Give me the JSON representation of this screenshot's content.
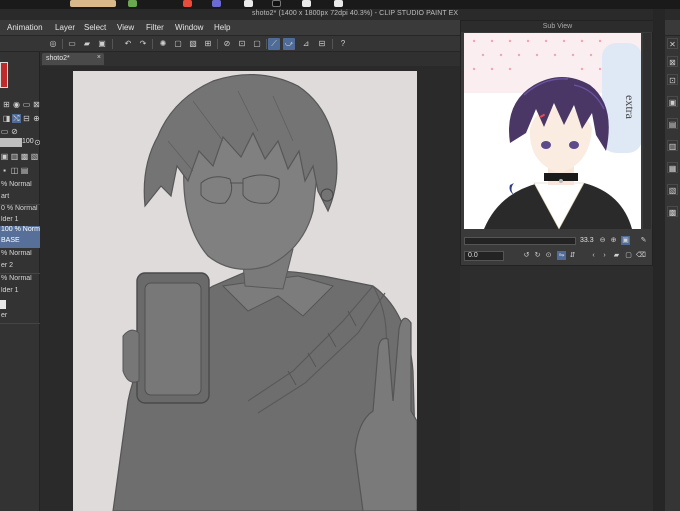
{
  "window": {
    "title": "shoto2* (1400 x 1800px 72dpi 40.3%) - CLIP STUDIO PAINT EX"
  },
  "menu": [
    "Animation",
    "Layer",
    "Select",
    "View",
    "Filter",
    "Window",
    "Help"
  ],
  "document_tab": {
    "label": "shoto2*",
    "close": "×"
  },
  "layer_panel": {
    "opacity_value": "100",
    "layers": [
      {
        "label": "% Normal",
        "selected": false
      },
      {
        "label": "art",
        "selected": false
      },
      {
        "label": "0 % Normal",
        "selected": false
      },
      {
        "label": "lder 1",
        "selected": false
      },
      {
        "label": "100 % Normal",
        "selected": true
      },
      {
        "label": "BASE",
        "selected": true
      },
      {
        "label": "% Normal",
        "selected": false
      },
      {
        "label": "er 2",
        "selected": false
      },
      {
        "label": "% Normal",
        "selected": false
      },
      {
        "label": "lder 1",
        "selected": false
      },
      {
        "label": "er",
        "selected": false
      }
    ]
  },
  "sub_view": {
    "header": "Sub View",
    "zoom": "33.3",
    "rotation": "0.0",
    "artwork_text": "extra"
  },
  "colors": {
    "accent": "#4f6c98",
    "paper": "#dedbda",
    "hair": "#4a3766"
  }
}
